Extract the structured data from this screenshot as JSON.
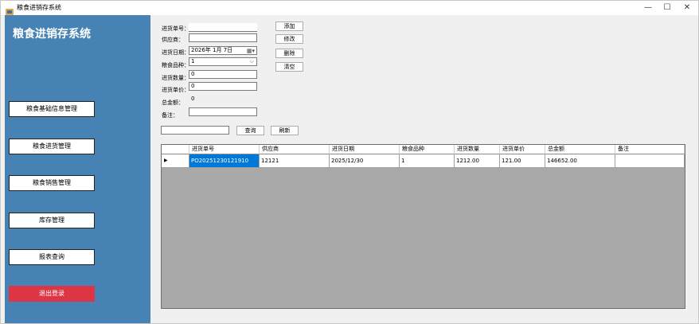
{
  "window": {
    "title": "粮食进销存系统",
    "minimize": "—",
    "maximize": "☐",
    "close": "✕"
  },
  "sidebar": {
    "title": "粮食进销存系统",
    "items": [
      {
        "label": "粮食基础信息管理"
      },
      {
        "label": "粮食进货管理"
      },
      {
        "label": "粮食销售管理"
      },
      {
        "label": "库存管理"
      },
      {
        "label": "报表查询"
      },
      {
        "label": "退出登录"
      }
    ]
  },
  "form": {
    "order_no_label": "进货单号：",
    "order_no_value": "",
    "supplier_label": "供应商：",
    "supplier_value": "",
    "date_label": "进货日期：",
    "date_value": "2026年 1月 7日",
    "grain_label": "粮食品种：",
    "grain_value": "1",
    "qty_label": "进货数量：",
    "qty_value": "0",
    "price_label": "进货单价：",
    "price_value": "0",
    "total_label": "总金额：",
    "total_value": "0",
    "note_label": "备注：",
    "note_value": ""
  },
  "actions": {
    "add": "添加",
    "edit": "修改",
    "delete": "删除",
    "clear": "清空"
  },
  "search": {
    "value": "",
    "query": "查询",
    "refresh": "刷新"
  },
  "grid": {
    "columns": [
      "进货单号",
      "供应商",
      "进货日期",
      "粮食品种",
      "进货数量",
      "进货单价",
      "总金额",
      "备注"
    ],
    "rows": [
      {
        "indicator": "▶",
        "cells": [
          "PO20251230121910",
          "12121",
          "2025/12/30",
          "1",
          "1212.00",
          "121.00",
          "146652.00",
          ""
        ]
      }
    ]
  },
  "colors": {
    "sidebar": "#4682b4",
    "logout": "#dc3545",
    "selection": "#0078d7",
    "grid_background": "#a9a9a9"
  }
}
